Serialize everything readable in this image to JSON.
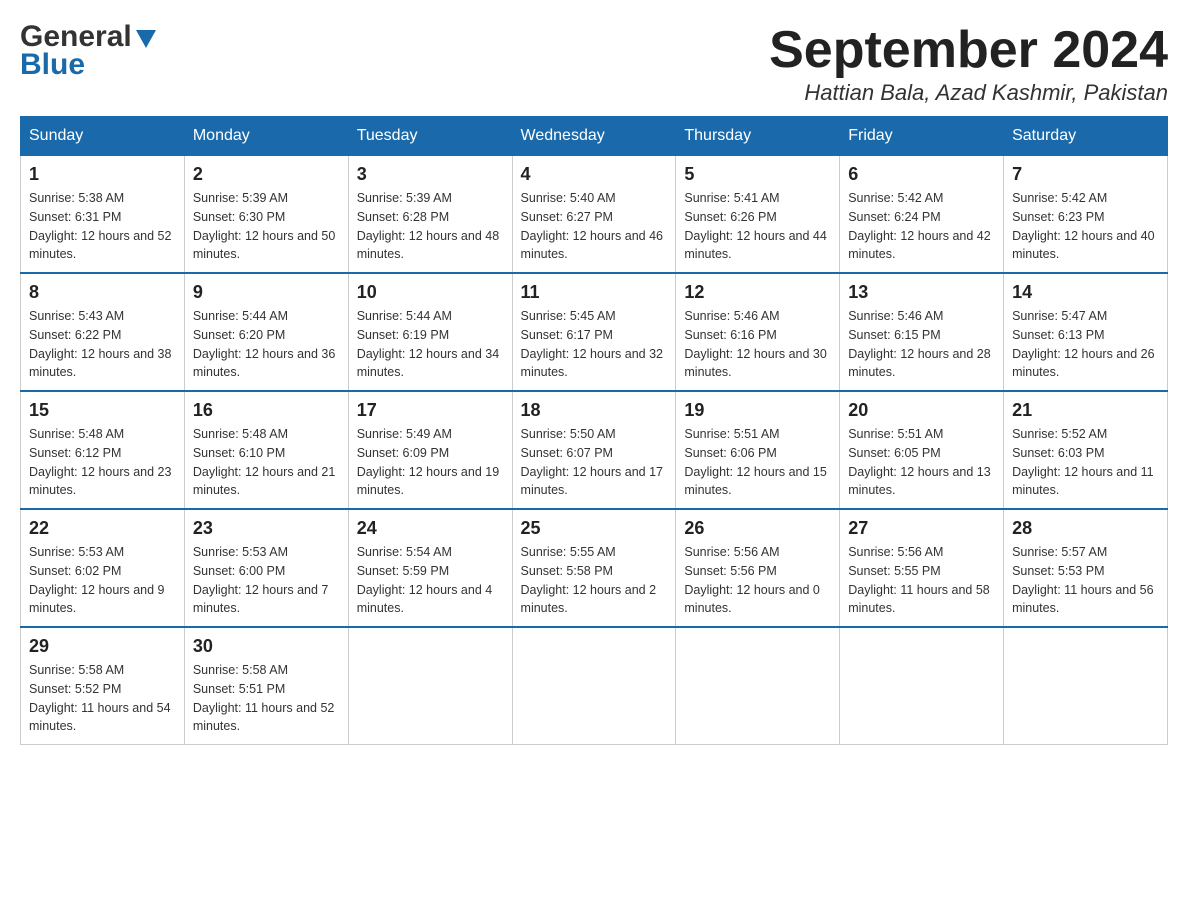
{
  "header": {
    "logo_general": "General",
    "logo_blue": "Blue",
    "month_title": "September 2024",
    "location": "Hattian Bala, Azad Kashmir, Pakistan"
  },
  "columns": [
    "Sunday",
    "Monday",
    "Tuesday",
    "Wednesday",
    "Thursday",
    "Friday",
    "Saturday"
  ],
  "weeks": [
    [
      {
        "day": "1",
        "sunrise": "Sunrise: 5:38 AM",
        "sunset": "Sunset: 6:31 PM",
        "daylight": "Daylight: 12 hours and 52 minutes."
      },
      {
        "day": "2",
        "sunrise": "Sunrise: 5:39 AM",
        "sunset": "Sunset: 6:30 PM",
        "daylight": "Daylight: 12 hours and 50 minutes."
      },
      {
        "day": "3",
        "sunrise": "Sunrise: 5:39 AM",
        "sunset": "Sunset: 6:28 PM",
        "daylight": "Daylight: 12 hours and 48 minutes."
      },
      {
        "day": "4",
        "sunrise": "Sunrise: 5:40 AM",
        "sunset": "Sunset: 6:27 PM",
        "daylight": "Daylight: 12 hours and 46 minutes."
      },
      {
        "day": "5",
        "sunrise": "Sunrise: 5:41 AM",
        "sunset": "Sunset: 6:26 PM",
        "daylight": "Daylight: 12 hours and 44 minutes."
      },
      {
        "day": "6",
        "sunrise": "Sunrise: 5:42 AM",
        "sunset": "Sunset: 6:24 PM",
        "daylight": "Daylight: 12 hours and 42 minutes."
      },
      {
        "day": "7",
        "sunrise": "Sunrise: 5:42 AM",
        "sunset": "Sunset: 6:23 PM",
        "daylight": "Daylight: 12 hours and 40 minutes."
      }
    ],
    [
      {
        "day": "8",
        "sunrise": "Sunrise: 5:43 AM",
        "sunset": "Sunset: 6:22 PM",
        "daylight": "Daylight: 12 hours and 38 minutes."
      },
      {
        "day": "9",
        "sunrise": "Sunrise: 5:44 AM",
        "sunset": "Sunset: 6:20 PM",
        "daylight": "Daylight: 12 hours and 36 minutes."
      },
      {
        "day": "10",
        "sunrise": "Sunrise: 5:44 AM",
        "sunset": "Sunset: 6:19 PM",
        "daylight": "Daylight: 12 hours and 34 minutes."
      },
      {
        "day": "11",
        "sunrise": "Sunrise: 5:45 AM",
        "sunset": "Sunset: 6:17 PM",
        "daylight": "Daylight: 12 hours and 32 minutes."
      },
      {
        "day": "12",
        "sunrise": "Sunrise: 5:46 AM",
        "sunset": "Sunset: 6:16 PM",
        "daylight": "Daylight: 12 hours and 30 minutes."
      },
      {
        "day": "13",
        "sunrise": "Sunrise: 5:46 AM",
        "sunset": "Sunset: 6:15 PM",
        "daylight": "Daylight: 12 hours and 28 minutes."
      },
      {
        "day": "14",
        "sunrise": "Sunrise: 5:47 AM",
        "sunset": "Sunset: 6:13 PM",
        "daylight": "Daylight: 12 hours and 26 minutes."
      }
    ],
    [
      {
        "day": "15",
        "sunrise": "Sunrise: 5:48 AM",
        "sunset": "Sunset: 6:12 PM",
        "daylight": "Daylight: 12 hours and 23 minutes."
      },
      {
        "day": "16",
        "sunrise": "Sunrise: 5:48 AM",
        "sunset": "Sunset: 6:10 PM",
        "daylight": "Daylight: 12 hours and 21 minutes."
      },
      {
        "day": "17",
        "sunrise": "Sunrise: 5:49 AM",
        "sunset": "Sunset: 6:09 PM",
        "daylight": "Daylight: 12 hours and 19 minutes."
      },
      {
        "day": "18",
        "sunrise": "Sunrise: 5:50 AM",
        "sunset": "Sunset: 6:07 PM",
        "daylight": "Daylight: 12 hours and 17 minutes."
      },
      {
        "day": "19",
        "sunrise": "Sunrise: 5:51 AM",
        "sunset": "Sunset: 6:06 PM",
        "daylight": "Daylight: 12 hours and 15 minutes."
      },
      {
        "day": "20",
        "sunrise": "Sunrise: 5:51 AM",
        "sunset": "Sunset: 6:05 PM",
        "daylight": "Daylight: 12 hours and 13 minutes."
      },
      {
        "day": "21",
        "sunrise": "Sunrise: 5:52 AM",
        "sunset": "Sunset: 6:03 PM",
        "daylight": "Daylight: 12 hours and 11 minutes."
      }
    ],
    [
      {
        "day": "22",
        "sunrise": "Sunrise: 5:53 AM",
        "sunset": "Sunset: 6:02 PM",
        "daylight": "Daylight: 12 hours and 9 minutes."
      },
      {
        "day": "23",
        "sunrise": "Sunrise: 5:53 AM",
        "sunset": "Sunset: 6:00 PM",
        "daylight": "Daylight: 12 hours and 7 minutes."
      },
      {
        "day": "24",
        "sunrise": "Sunrise: 5:54 AM",
        "sunset": "Sunset: 5:59 PM",
        "daylight": "Daylight: 12 hours and 4 minutes."
      },
      {
        "day": "25",
        "sunrise": "Sunrise: 5:55 AM",
        "sunset": "Sunset: 5:58 PM",
        "daylight": "Daylight: 12 hours and 2 minutes."
      },
      {
        "day": "26",
        "sunrise": "Sunrise: 5:56 AM",
        "sunset": "Sunset: 5:56 PM",
        "daylight": "Daylight: 12 hours and 0 minutes."
      },
      {
        "day": "27",
        "sunrise": "Sunrise: 5:56 AM",
        "sunset": "Sunset: 5:55 PM",
        "daylight": "Daylight: 11 hours and 58 minutes."
      },
      {
        "day": "28",
        "sunrise": "Sunrise: 5:57 AM",
        "sunset": "Sunset: 5:53 PM",
        "daylight": "Daylight: 11 hours and 56 minutes."
      }
    ],
    [
      {
        "day": "29",
        "sunrise": "Sunrise: 5:58 AM",
        "sunset": "Sunset: 5:52 PM",
        "daylight": "Daylight: 11 hours and 54 minutes."
      },
      {
        "day": "30",
        "sunrise": "Sunrise: 5:58 AM",
        "sunset": "Sunset: 5:51 PM",
        "daylight": "Daylight: 11 hours and 52 minutes."
      },
      null,
      null,
      null,
      null,
      null
    ]
  ]
}
